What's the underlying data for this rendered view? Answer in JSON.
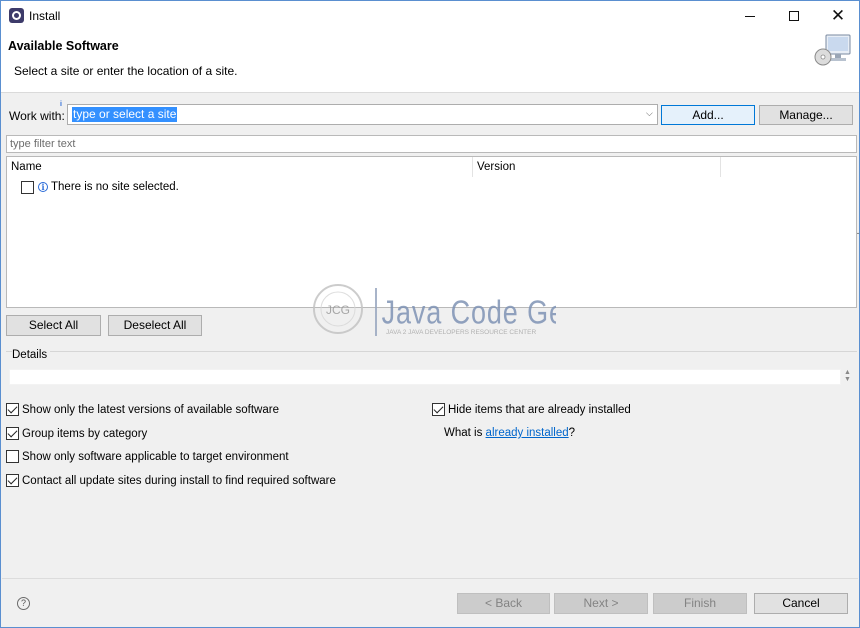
{
  "window": {
    "title": "Install",
    "close_glyph": "✕"
  },
  "header": {
    "title": "Available Software",
    "subtitle": "Select a site or enter the location of a site."
  },
  "work_with": {
    "label": "Work with:",
    "value": "type or select a site",
    "add_label": "Add...",
    "manage_label": "Manage..."
  },
  "filter": {
    "placeholder": "type filter text"
  },
  "table": {
    "columns": [
      "Name",
      "Version"
    ],
    "rows": [
      {
        "text": "There is no site selected.",
        "checked": false,
        "icon": "info-icon"
      }
    ]
  },
  "selection_buttons": {
    "select_all": "Select All",
    "deselect_all": "Deselect All"
  },
  "details": {
    "title": "Details"
  },
  "options": {
    "latest_versions": {
      "label": "Show only the latest versions of available software",
      "checked": true
    },
    "group_by_category": {
      "label": "Group items by category",
      "checked": true
    },
    "target_environment": {
      "label": "Show only software applicable to target environment",
      "checked": false
    },
    "contact_all_sites": {
      "label": "Contact all update sites during install to find required software",
      "checked": true
    },
    "hide_installed": {
      "label": "Hide items that are already installed",
      "checked": true
    },
    "what_is_prefix": "What is ",
    "already_installed_link": "already installed",
    "what_is_suffix": "?"
  },
  "watermark": {
    "logo_text": "JCG",
    "brand": "Java Code Geeks",
    "tagline": "JAVA 2 JAVA DEVELOPERS RESOURCE CENTER"
  },
  "footer": {
    "back_label": "< Back",
    "next_label": "Next >",
    "finish_label": "Finish",
    "cancel_label": "Cancel"
  },
  "colors": {
    "selection": "#3390ff",
    "link": "#0066cc",
    "default_button_border": "#0078d7",
    "window_border": "#5a8fd0"
  }
}
